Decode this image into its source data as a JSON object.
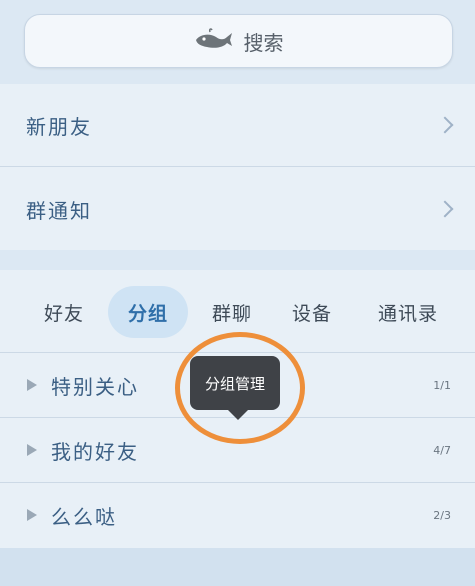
{
  "search": {
    "label": "搜索",
    "icon": "whale-icon"
  },
  "rows": [
    {
      "label": "新朋友"
    },
    {
      "label": "群通知"
    }
  ],
  "tabs": [
    {
      "label": "好友",
      "active": false
    },
    {
      "label": "分组",
      "active": true
    },
    {
      "label": "群聊",
      "active": false
    },
    {
      "label": "设备",
      "active": false
    },
    {
      "label": "通讯录",
      "active": false
    }
  ],
  "groups": [
    {
      "name": "特别关心",
      "count": "1/1"
    },
    {
      "name": "我的好友",
      "count": "4/7"
    },
    {
      "name": "么么哒",
      "count": "2/3"
    }
  ],
  "tooltip": {
    "label": "分组管理"
  },
  "colors": {
    "accent": "#2f6fa9",
    "highlight": "#ee8f3a",
    "tooltip_bg": "#3f4247"
  }
}
